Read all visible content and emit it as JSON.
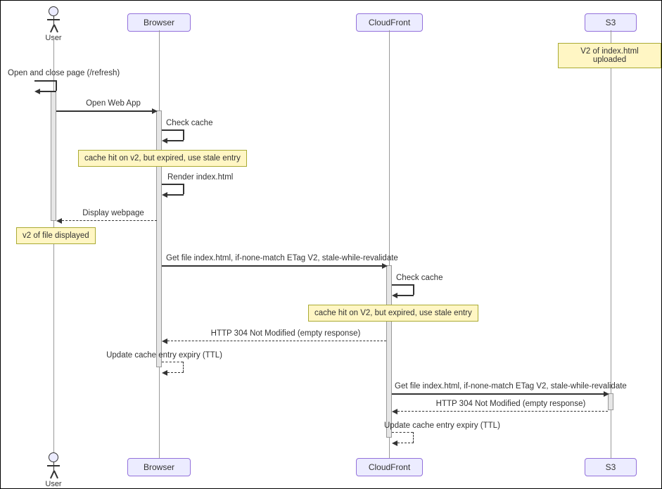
{
  "actors": {
    "user": "User",
    "browser": "Browser",
    "cloudfront": "CloudFront",
    "s3": "S3"
  },
  "notes": {
    "s3_upload": "V2 of index.html uploaded",
    "browser_cache_hit": "cache hit on v2, but expired, use stale entry",
    "file_displayed": "v2 of file displayed",
    "cf_cache_hit": "cache hit on V2, but expired, use stale entry"
  },
  "messages": {
    "open_close": "Open and close page (/refresh)",
    "open_app": "Open Web App",
    "check_cache_b": "Check cache",
    "render_index": "Render index.html",
    "display_page": "Display webpage",
    "get_file_cf": "Get file index.html, if-none-match ETag V2, stale-while-revalidate",
    "check_cache_cf": "Check cache",
    "http304_cf": "HTTP 304 Not Modified (empty response)",
    "update_ttl_b": "Update cache entry expiry (TTL)",
    "get_file_s3": "Get file index.html, if-none-match ETag V2, stale-while-revalidate",
    "http304_s3": "HTTP 304 Not Modified (empty response)",
    "update_ttl_cf": "Update cache entry expiry (TTL)"
  }
}
